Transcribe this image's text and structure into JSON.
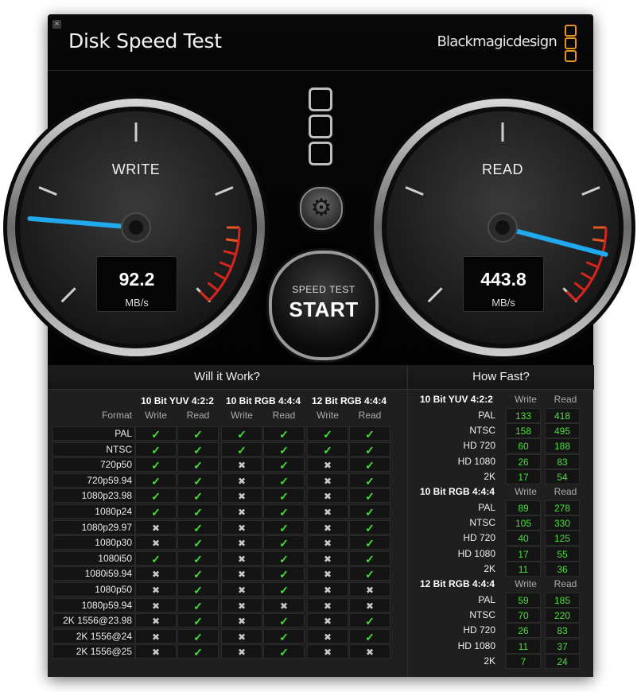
{
  "window": {
    "title": "Disk Speed Test",
    "brand": "Blackmagicdesign",
    "close_glyph": "×"
  },
  "gauges": {
    "write": {
      "label": "WRITE",
      "value": "92.2",
      "unit": "MB/s"
    },
    "read": {
      "label": "READ",
      "value": "443.8",
      "unit": "MB/s"
    }
  },
  "start_button": {
    "subtitle": "SPEED TEST",
    "label": "START"
  },
  "settings_icon": "gear-icon",
  "will_it_work": {
    "title": "Will it Work?",
    "format_header": "Format",
    "groups": [
      "10 Bit YUV 4:2:2",
      "10 Bit RGB 4:4:4",
      "12 Bit RGB 4:4:4"
    ],
    "subcols": [
      "Write",
      "Read"
    ],
    "rows": [
      {
        "format": "PAL",
        "results": [
          1,
          1,
          1,
          1,
          1,
          1
        ]
      },
      {
        "format": "NTSC",
        "results": [
          1,
          1,
          1,
          1,
          1,
          1
        ]
      },
      {
        "format": "720p50",
        "results": [
          1,
          1,
          0,
          1,
          0,
          1
        ]
      },
      {
        "format": "720p59.94",
        "results": [
          1,
          1,
          0,
          1,
          0,
          1
        ]
      },
      {
        "format": "1080p23.98",
        "results": [
          1,
          1,
          0,
          1,
          0,
          1
        ]
      },
      {
        "format": "1080p24",
        "results": [
          1,
          1,
          0,
          1,
          0,
          1
        ]
      },
      {
        "format": "1080p29.97",
        "results": [
          0,
          1,
          0,
          1,
          0,
          1
        ]
      },
      {
        "format": "1080p30",
        "results": [
          0,
          1,
          0,
          1,
          0,
          1
        ]
      },
      {
        "format": "1080i50",
        "results": [
          1,
          1,
          0,
          1,
          0,
          1
        ]
      },
      {
        "format": "1080i59.94",
        "results": [
          0,
          1,
          0,
          1,
          0,
          1
        ]
      },
      {
        "format": "1080p50",
        "results": [
          0,
          1,
          0,
          1,
          0,
          0
        ]
      },
      {
        "format": "1080p59.94",
        "results": [
          0,
          1,
          0,
          0,
          0,
          0
        ]
      },
      {
        "format": "2K 1556@23.98",
        "results": [
          0,
          1,
          0,
          1,
          0,
          1
        ]
      },
      {
        "format": "2K 1556@24",
        "results": [
          0,
          1,
          0,
          1,
          0,
          1
        ]
      },
      {
        "format": "2K 1556@25",
        "results": [
          0,
          1,
          0,
          1,
          0,
          0
        ]
      }
    ],
    "ok_glyph": "✓",
    "no_glyph": "✖"
  },
  "how_fast": {
    "title": "How Fast?",
    "subcols": [
      "Write",
      "Read"
    ],
    "groups": [
      {
        "name": "10 Bit YUV 4:2:2",
        "rows": [
          {
            "format": "PAL",
            "write": "133",
            "read": "418"
          },
          {
            "format": "NTSC",
            "write": "158",
            "read": "495"
          },
          {
            "format": "HD 720",
            "write": "60",
            "read": "188"
          },
          {
            "format": "HD 1080",
            "write": "26",
            "read": "83"
          },
          {
            "format": "2K",
            "write": "17",
            "read": "54"
          }
        ]
      },
      {
        "name": "10 Bit RGB 4:4:4",
        "rows": [
          {
            "format": "PAL",
            "write": "89",
            "read": "278"
          },
          {
            "format": "NTSC",
            "write": "105",
            "read": "330"
          },
          {
            "format": "HD 720",
            "write": "40",
            "read": "125"
          },
          {
            "format": "HD 1080",
            "write": "17",
            "read": "55"
          },
          {
            "format": "2K",
            "write": "11",
            "read": "36"
          }
        ]
      },
      {
        "name": "12 Bit RGB 4:4:4",
        "rows": [
          {
            "format": "PAL",
            "write": "59",
            "read": "185"
          },
          {
            "format": "NTSC",
            "write": "70",
            "read": "220"
          },
          {
            "format": "HD 720",
            "write": "26",
            "read": "83"
          },
          {
            "format": "HD 1080",
            "write": "11",
            "read": "37"
          },
          {
            "format": "2K",
            "write": "7",
            "read": "24"
          }
        ]
      }
    ]
  },
  "colors": {
    "needle": "#21a9ee",
    "check": "#44e235",
    "logo": "#e8951f",
    "redzone": "#d8251b",
    "orangezone": "#e8561f"
  }
}
